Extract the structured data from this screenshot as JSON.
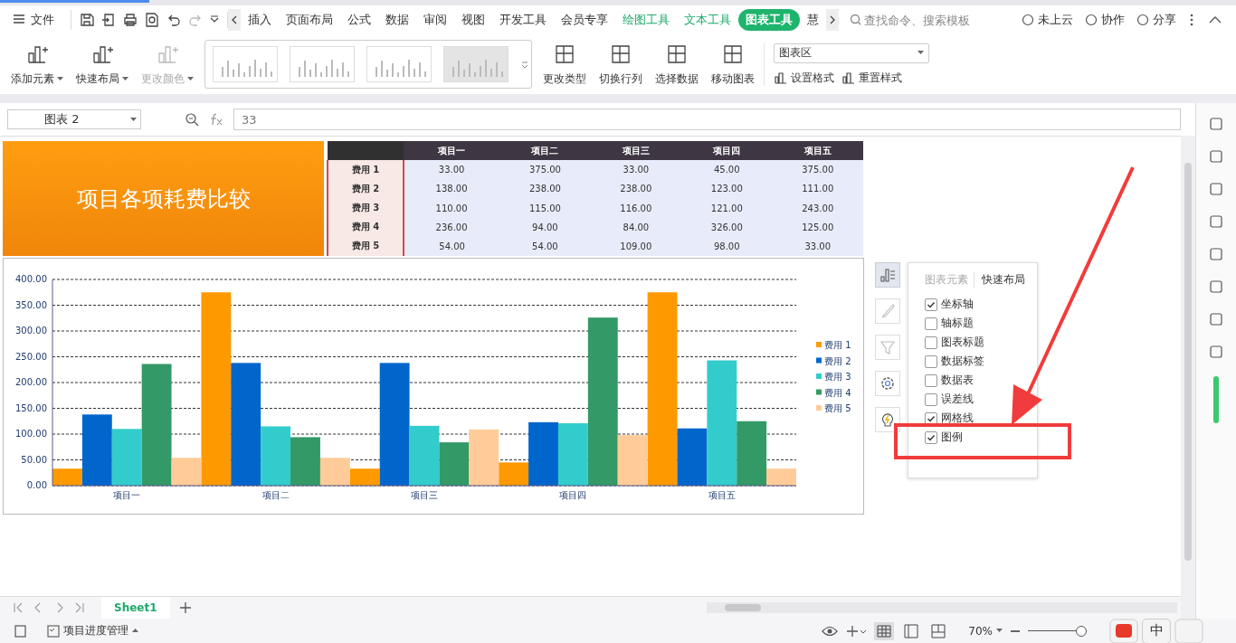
{
  "menu": {
    "file": "文件",
    "tabs": [
      {
        "label": "插入",
        "kind": "normal",
        "selected": false
      },
      {
        "label": "页面布局",
        "kind": "normal",
        "selected": false
      },
      {
        "label": "公式",
        "kind": "normal",
        "selected": false
      },
      {
        "label": "数据",
        "kind": "normal",
        "selected": false
      },
      {
        "label": "审阅",
        "kind": "normal",
        "selected": false
      },
      {
        "label": "视图",
        "kind": "normal",
        "selected": false
      },
      {
        "label": "开发工具",
        "kind": "normal",
        "selected": false
      },
      {
        "label": "会员专享",
        "kind": "normal",
        "selected": false
      },
      {
        "label": "绘图工具",
        "kind": "context",
        "selected": false
      },
      {
        "label": "文本工具",
        "kind": "context",
        "selected": false
      },
      {
        "label": "图表工具",
        "kind": "context",
        "selected": true
      },
      {
        "label": "慧",
        "kind": "normal",
        "selected": false
      }
    ],
    "search": {
      "placeholder": "查找命令、搜索模板"
    },
    "actions": [
      "未上云",
      "协作",
      "分享"
    ]
  },
  "ribbon": {
    "left_buttons": [
      {
        "label": "添加元素",
        "disabled": false
      },
      {
        "label": "快速布局",
        "disabled": false
      },
      {
        "label": "更改颜色",
        "disabled": true
      }
    ],
    "right_buttons": [
      "更改类型",
      "切换行列",
      "选择数据",
      "移动图表"
    ],
    "element_select": "图表区",
    "format_buttons": [
      "设置格式",
      "重置样式"
    ]
  },
  "formula_bar": {
    "name_box": "图表 2",
    "value": "33"
  },
  "title_block": "项目各项耗费比较",
  "data_table": {
    "columns": [
      "项目一",
      "项目二",
      "项目三",
      "项目四",
      "项目五"
    ],
    "rows": [
      {
        "label": "费用 1",
        "cells": [
          "33.00",
          "375.00",
          "33.00",
          "45.00",
          "375.00"
        ]
      },
      {
        "label": "费用 2",
        "cells": [
          "138.00",
          "238.00",
          "238.00",
          "123.00",
          "111.00"
        ]
      },
      {
        "label": "费用 3",
        "cells": [
          "110.00",
          "115.00",
          "116.00",
          "121.00",
          "243.00"
        ]
      },
      {
        "label": "费用 4",
        "cells": [
          "236.00",
          "94.00",
          "84.00",
          "326.00",
          "125.00"
        ]
      },
      {
        "label": "费用 5",
        "cells": [
          "54.00",
          "54.00",
          "109.00",
          "98.00",
          "33.00"
        ]
      }
    ]
  },
  "chart": {
    "chart_data": {
      "type": "bar",
      "categories": [
        "项目一",
        "项目二",
        "项目三",
        "项目四",
        "项目五"
      ],
      "series": [
        {
          "name": "费用 1",
          "color": "#ff9900",
          "values": [
            33,
            375,
            33,
            45,
            375
          ]
        },
        {
          "name": "费用 2",
          "color": "#0066cc",
          "values": [
            138,
            238,
            238,
            123,
            111
          ]
        },
        {
          "name": "费用 3",
          "color": "#33cccc",
          "values": [
            110,
            115,
            116,
            121,
            243
          ]
        },
        {
          "name": "费用 4",
          "color": "#339966",
          "values": [
            236,
            94,
            84,
            326,
            125
          ]
        },
        {
          "name": "费用 5",
          "color": "#ffcc99",
          "values": [
            54,
            54,
            109,
            98,
            33
          ]
        }
      ],
      "ylim": [
        0,
        400
      ],
      "grid": true,
      "legend": true,
      "yticks": [
        {
          "value": 0,
          "label": "0.00"
        },
        {
          "value": 50,
          "label": "50.00"
        },
        {
          "value": 100,
          "label": "100.00"
        },
        {
          "value": 150,
          "label": "150.00"
        },
        {
          "value": 200,
          "label": "200.00"
        },
        {
          "value": 250,
          "label": "250.00"
        },
        {
          "value": 300,
          "label": "300.00"
        },
        {
          "value": 350,
          "label": "350.00"
        },
        {
          "value": 400,
          "label": "400.00"
        }
      ]
    }
  },
  "chart_elements_panel": {
    "tabs": [
      {
        "label": "图表元素",
        "selected": true
      },
      {
        "label": "快速布局",
        "selected": false
      }
    ],
    "items": [
      {
        "label": "坐标轴",
        "checked": true
      },
      {
        "label": "轴标题",
        "checked": false
      },
      {
        "label": "图表标题",
        "checked": false
      },
      {
        "label": "数据标签",
        "checked": false
      },
      {
        "label": "数据表",
        "checked": false
      },
      {
        "label": "误差线",
        "checked": false
      },
      {
        "label": "网格线",
        "checked": true
      },
      {
        "label": "图例",
        "checked": true
      }
    ]
  },
  "sheet_tabs": [
    {
      "label": "Sheet1",
      "selected": true
    }
  ],
  "status_bar": {
    "document": "项目进度管理",
    "zoom": "70%",
    "zoom_slider": {
      "level": 0.92
    },
    "ime": "中"
  }
}
